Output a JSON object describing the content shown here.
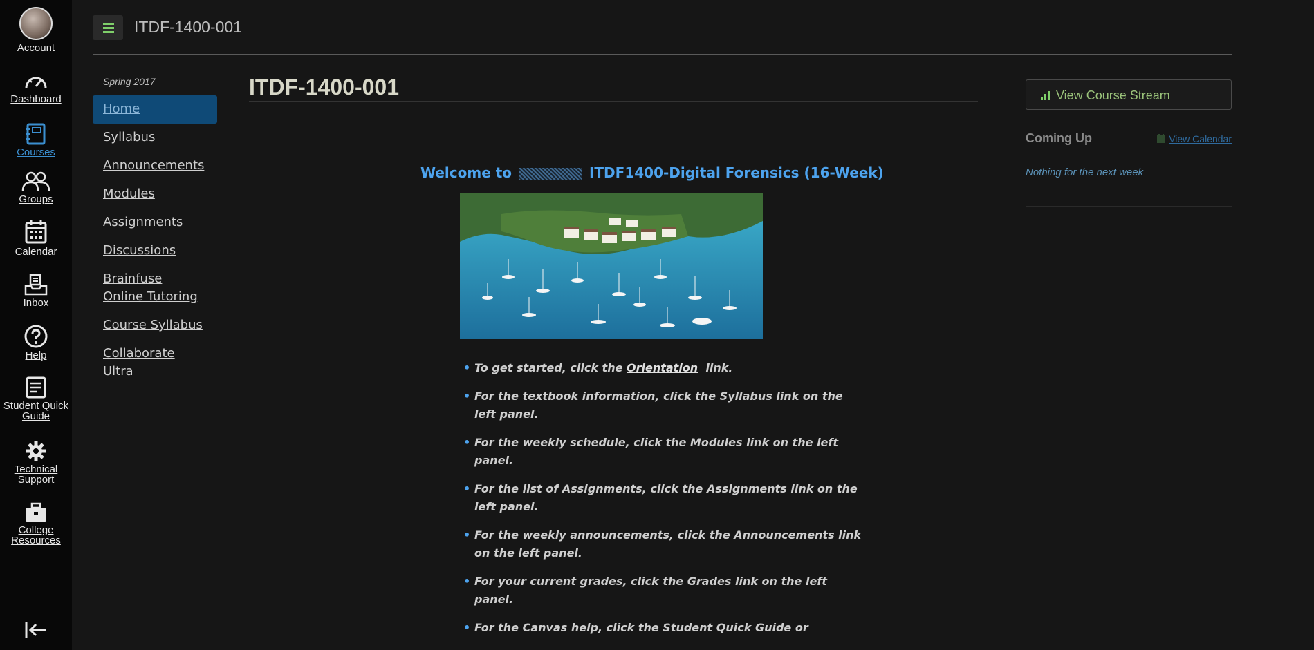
{
  "global_nav": {
    "items": [
      {
        "label": "Account",
        "icon": "avatar"
      },
      {
        "label": "Dashboard",
        "icon": "speedometer-icon"
      },
      {
        "label": "Courses",
        "icon": "book-icon",
        "active": true
      },
      {
        "label": "Groups",
        "icon": "users-icon"
      },
      {
        "label": "Calendar",
        "icon": "calendar-icon"
      },
      {
        "label": "Inbox",
        "icon": "inbox-icon"
      },
      {
        "label": "Help",
        "icon": "help-icon"
      },
      {
        "label": "Student Quick Guide",
        "icon": "document-icon"
      },
      {
        "label": "Technical Support",
        "icon": "gear-icon"
      },
      {
        "label": "College Resources",
        "icon": "briefcase-icon"
      }
    ]
  },
  "header": {
    "breadcrumb": "ITDF-1400-001"
  },
  "course_nav": {
    "term": "Spring 2017",
    "items": [
      {
        "label": "Home",
        "active": true
      },
      {
        "label": "Syllabus"
      },
      {
        "label": "Announcements"
      },
      {
        "label": "Modules"
      },
      {
        "label": "Assignments"
      },
      {
        "label": "Discussions"
      },
      {
        "label": "Brainfuse Online Tutoring"
      },
      {
        "label": "Course Syllabus"
      },
      {
        "label": "Collaborate Ultra"
      }
    ]
  },
  "content": {
    "title": "ITDF-1400-001",
    "welcome_prefix": "Welcome to",
    "welcome_suffix": "ITDF1400-Digital Forensics (16-Week)",
    "bullets": [
      {
        "pre": "To get started, click the ",
        "link": "Orientation",
        "post": "  link."
      },
      {
        "text": "For the textbook information, click the Syllabus link on the left panel."
      },
      {
        "text": "For the weekly schedule, click the Modules link on the left panel."
      },
      {
        "text": "For the list of Assignments, click the Assignments link on the left panel."
      },
      {
        "text": "For the weekly announcements, click the Announcements link on the left panel."
      },
      {
        "text": "For your current grades, click the Grades link on the left panel."
      },
      {
        "text": "For the Canvas help, click the Student Quick Guide or"
      }
    ]
  },
  "sidebar": {
    "stream_button": "View Course Stream",
    "coming_up_heading": "Coming Up",
    "view_calendar": "View Calendar",
    "nothing_text": "Nothing for the next week"
  },
  "colors": {
    "accent": "#4da3ee",
    "active_nav_bg": "#0f4a77",
    "stream_green": "#9ac27a"
  }
}
